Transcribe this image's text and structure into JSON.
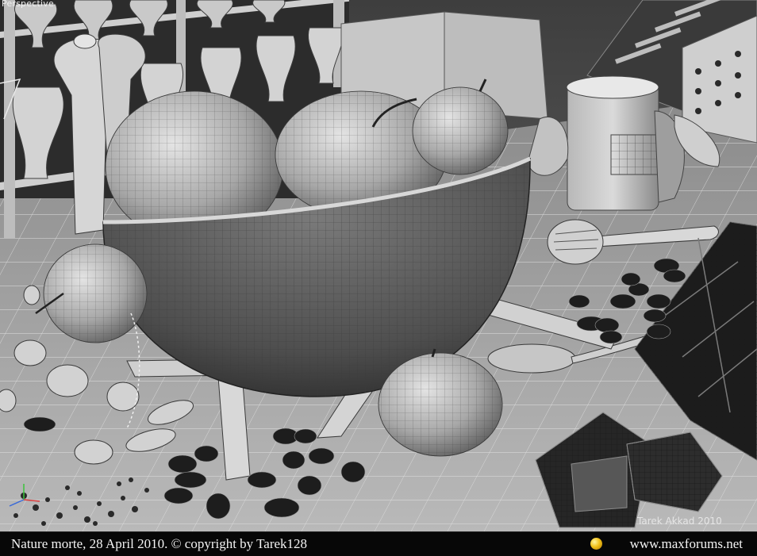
{
  "viewport": {
    "label": "Perspective",
    "watermark": "Tarek Akkad 2010"
  },
  "footer": {
    "caption": "Nature morte,  28 April 2010.  © copyright by Tarek128",
    "site": "www.maxforums.net",
    "globe_icon": "globe-icon"
  },
  "colors": {
    "viewport_bg": "#6f6f6f",
    "footer_bg": "#070707",
    "footer_text": "#f4f4f4",
    "mesh_shade": "#8e8e8e"
  }
}
